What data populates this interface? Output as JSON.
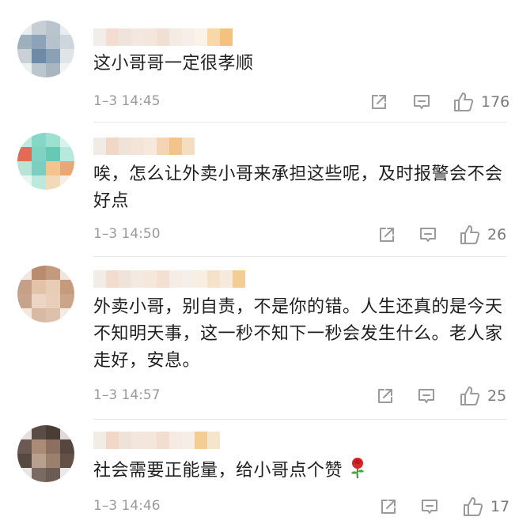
{
  "colors": {
    "text": "#1f1f1f",
    "meta": "#9a9a9a",
    "icon": "#9a9a9a"
  },
  "icons": {
    "share": "share-icon",
    "comment": "comment-icon",
    "like": "thumbs-up-icon",
    "emoji": "rose-emoji-icon"
  },
  "comments": [
    {
      "text": "这小哥哥一定很孝顺",
      "time": "1–3 14:45",
      "likes": "176"
    },
    {
      "text": "唉，怎么让外卖小哥来承担这些呢，及时报警会不会好点",
      "time": "1–3 14:50",
      "likes": "26"
    },
    {
      "text": "外卖小哥，别自责，不是你的错。人生还真的是今天不知明天事，这一秒不知下一秒会发生什么。老人家走好，安息。",
      "time": "1–3 14:57",
      "likes": "25"
    },
    {
      "text": "社会需要正能量，给小哥点个赞",
      "time": "1–3 14:46",
      "likes": "17"
    }
  ]
}
